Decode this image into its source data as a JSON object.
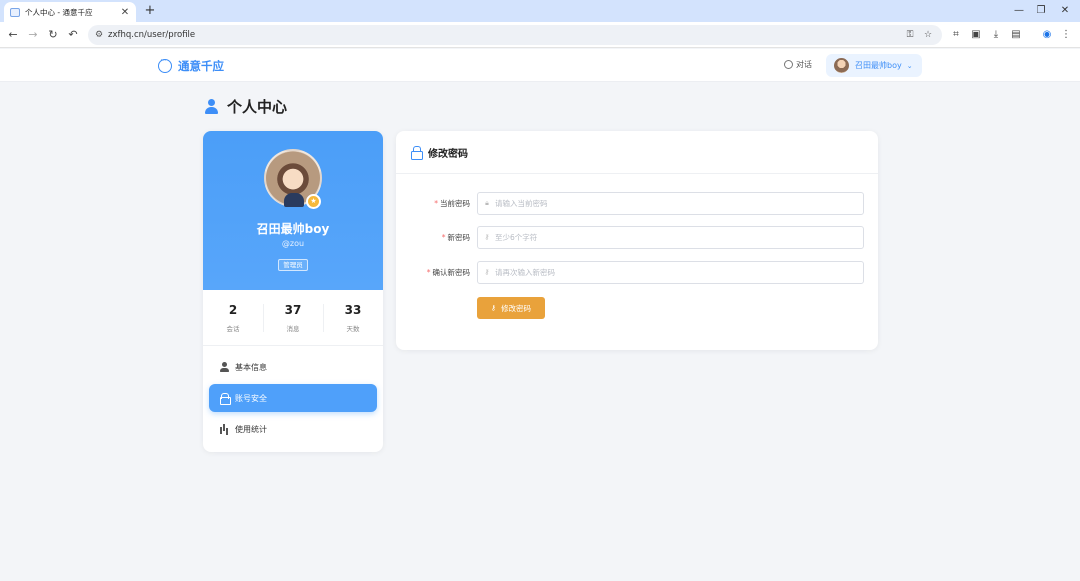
{
  "browser": {
    "tab_title": "个人中心 - 通意千应",
    "tab_close": "✕",
    "new_tab": "+",
    "url": "zxfhq.cn/user/profile",
    "win_minimize": "—",
    "win_restore": "❐",
    "win_close": "✕"
  },
  "header": {
    "logo_text": "通意千应",
    "chat_label": "对话",
    "user_name": "召田最帅boy",
    "chevron": "⌄"
  },
  "page": {
    "title": "个人中心"
  },
  "profile": {
    "name": "召田最帅boy",
    "handle": "@zou",
    "role": "管理员",
    "badge_icon": "★",
    "stats": [
      {
        "value": "2",
        "label": "会话"
      },
      {
        "value": "37",
        "label": "消息"
      },
      {
        "value": "33",
        "label": "天数"
      }
    ],
    "menu": [
      {
        "label": "基本信息",
        "icon": "user-icon"
      },
      {
        "label": "账号安全",
        "icon": "lock-icon"
      },
      {
        "label": "使用统计",
        "icon": "bar-chart-icon"
      }
    ]
  },
  "password_form": {
    "title": "修改密码",
    "fields": [
      {
        "label": "当前密码",
        "placeholder": "请输入当前密码",
        "required": "*"
      },
      {
        "label": "新密码",
        "placeholder": "至少6个字符",
        "required": "*"
      },
      {
        "label": "确认新密码",
        "placeholder": "请再次输入新密码",
        "required": "*"
      }
    ],
    "submit_label": "修改密码",
    "key_icon": "⚷"
  },
  "colors": {
    "primary": "#3d8ef7",
    "hero_blue": "#4b9ef8",
    "submit_orange": "#e9a23b",
    "required_red": "#f56c6c"
  }
}
